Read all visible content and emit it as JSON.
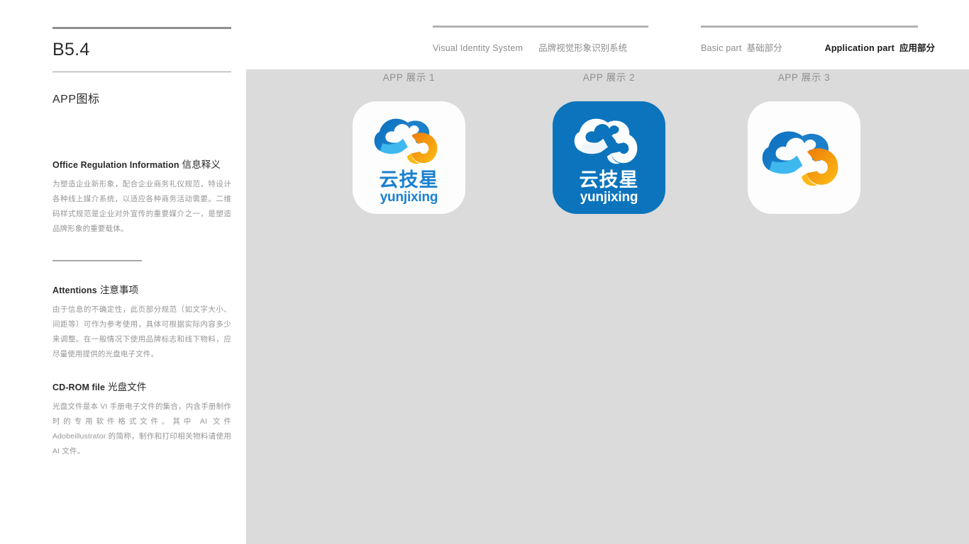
{
  "header": {
    "nav_groups": [
      {
        "name": "visual-identity-system",
        "en": "Visual Identity System",
        "cn": "品牌视觉形象识别系统",
        "active": false
      },
      {
        "name": "parts",
        "basic_en": "Basic part",
        "basic_cn": "基础部分",
        "application_en": "Application part",
        "application_cn": "应用部分"
      }
    ]
  },
  "sidebar": {
    "page_code": "B5.4",
    "page_title": "APP图标",
    "sections": [
      {
        "head_en": "Office Regulation Information",
        "head_cn": "信息释义",
        "body": "为塑造企业新形象，配合企业商务礼仪规范，特设计各种线上媒介系统，以适应各种商务活动需要。二维码样式规范是企业对外宣传的重要媒介之一，是塑造品牌形象的重要载体。"
      },
      {
        "head_en": "Attentions",
        "head_cn": "注意事项",
        "body": "由于信息的不确定性，此页部分规范（如文字大小、间距等）可作为参考使用，具体可根据实际内容多少来调整。在一般情况下使用品牌标志和线下物料，应尽量使用提供的光盘电子文件。"
      },
      {
        "head_en": "CD-ROM file",
        "head_cn": "光盘文件",
        "body": "光盘文件是本 VI 手册电子文件的集合，内含手册制作时的专用软件格式文件。其中 AI 文件 Adobeillustrator 的简称，制作和打印相关物料请使用 AI 文件。"
      }
    ]
  },
  "stage": {
    "background_color": "#dadbda",
    "icons": [
      {
        "caption": "APP 展示 1",
        "tile_style": "white",
        "tile_color": "#fdfdfd",
        "has_wordmark": true,
        "wordmark_cn": "云技星",
        "wordmark_en": "yunjixing",
        "wordmark_tone": "blue"
      },
      {
        "caption": "APP 展示 2",
        "tile_style": "blue",
        "tile_color": "#0b74bd",
        "has_wordmark": true,
        "wordmark_cn": "云技星",
        "wordmark_en": "yunjixing",
        "wordmark_tone": "white"
      },
      {
        "caption": "APP 展示 3",
        "tile_style": "white",
        "tile_color": "#fdfdfd",
        "has_wordmark": false,
        "wordmark_cn": "",
        "wordmark_en": "",
        "wordmark_tone": "blue"
      }
    ]
  },
  "brand_colors": {
    "cloud_blue_dark": "#0a6ebd",
    "cloud_blue_mid": "#1b7fc9",
    "cloud_blue_light": "#3fb7ef",
    "ring_orange": "#ef7d0a",
    "ring_yellow": "#fbb814",
    "rule_gray": "#b2b2b2",
    "body_text_gray": "#969696",
    "heading_dark": "#2b2b2b"
  }
}
